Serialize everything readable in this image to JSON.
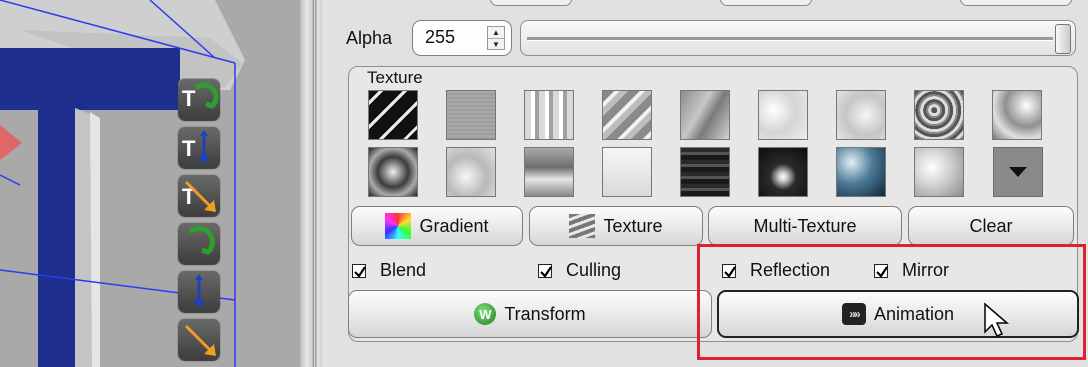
{
  "alpha": {
    "label": "Alpha",
    "value": "255",
    "level": 1.0
  },
  "texture": {
    "title": "Texture",
    "swatches": [
      "diagonal-stripes-dark",
      "noise-gray",
      "vertical-stripes",
      "diagonal-stripes-light",
      "streaks-gray",
      "marble-white",
      "marble-light",
      "rock-rough",
      "swirl-silver",
      "swirl-dark",
      "marble-cloud",
      "wave-horizontal",
      "gradient-white",
      "streaks-dark",
      "spotlight-dark",
      "glow-blue",
      "radial-soft"
    ]
  },
  "buttons": {
    "gradient": "Gradient",
    "texture": "Texture",
    "multi_texture": "Multi-Texture",
    "clear": "Clear",
    "transform": "Transform",
    "animation": "Animation"
  },
  "checkboxes": {
    "blend": {
      "label": "Blend",
      "checked": true
    },
    "culling": {
      "label": "Culling",
      "checked": true
    },
    "reflection": {
      "label": "Reflection",
      "checked": true
    },
    "mirror": {
      "label": "Mirror",
      "checked": true
    }
  },
  "icons": {
    "gizmos": [
      "rotate-icon",
      "move-y-icon",
      "scale-icon",
      "rotate-icon",
      "move-y-icon",
      "scale-icon"
    ],
    "cursor": "arrow-cursor-icon",
    "more": "chevron-down-icon"
  },
  "colors": {
    "highlight": "#e02030",
    "letter_face": "#1e2f8f",
    "bounding_box": "#2b3cf0"
  }
}
